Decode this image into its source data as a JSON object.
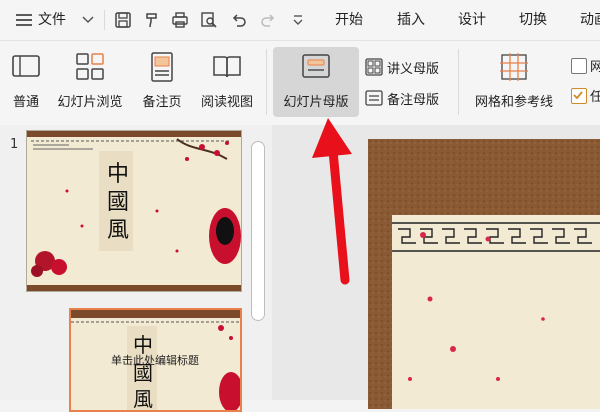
{
  "menubar": {
    "file_label": "文件",
    "tabs": [
      {
        "label": "开始"
      },
      {
        "label": "插入"
      },
      {
        "label": "设计"
      },
      {
        "label": "切换"
      },
      {
        "label": "动画"
      }
    ]
  },
  "ribbon": {
    "normal_label": "普通",
    "slide_sorter_label": "幻灯片浏览",
    "notes_page_label": "备注页",
    "reading_view_label": "阅读视图",
    "slide_master_label": "幻灯片母版",
    "handout_master_label": "讲义母版",
    "notes_master_label": "备注母版",
    "grid_guides_label": "网格和参考线",
    "checkbox_1_label": "网",
    "checkbox_2_label": "任"
  },
  "slides_panel": {
    "slide_1_number": "1",
    "thumb_2_title": "单击此处编辑标题"
  },
  "colors": {
    "accent_orange": "#e8814b",
    "active_bg": "#d6d6d6",
    "arrow_red": "#e8101a",
    "leather": "#8a5a34"
  }
}
